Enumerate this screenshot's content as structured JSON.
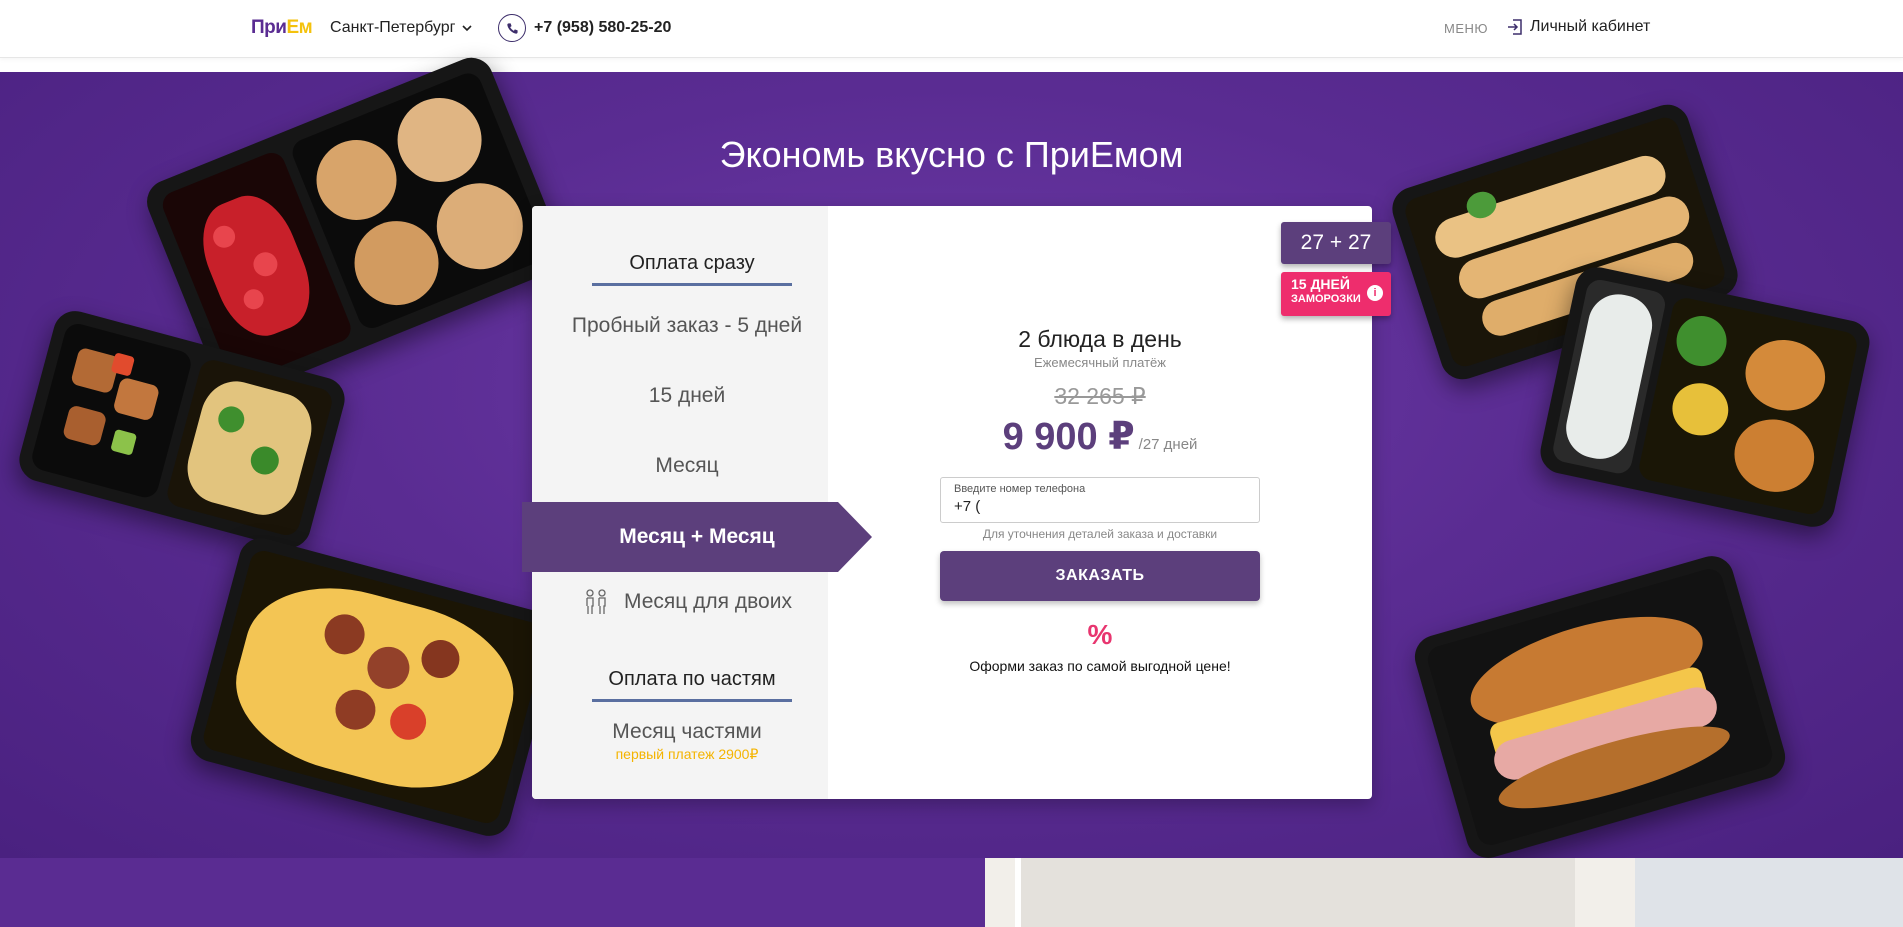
{
  "header": {
    "logo": {
      "part1": "При",
      "part2": "Ем"
    },
    "city": "Санкт-Петербург",
    "phone": "+7 (958) 580-25-20",
    "menu_label": "МЕНЮ",
    "cabinet_label": "Личный кабинет"
  },
  "hero": {
    "title": "Экономь вкусно с ПриЕмом"
  },
  "plans": {
    "group1_label": "Оплата сразу",
    "items": [
      {
        "label": "Пробный заказ - 5 дней"
      },
      {
        "label": "15 дней"
      },
      {
        "label": "Месяц"
      },
      {
        "label": "Месяц + Месяц",
        "active": true
      },
      {
        "label": "Месяц для двоих"
      }
    ],
    "group2_label": "Оплата по частям",
    "installment": {
      "label": "Месяц частями",
      "sub": "первый платеж 2900₽"
    }
  },
  "offer": {
    "title": "2 блюда в день",
    "subtitle": "Ежемесячный платёж",
    "old_price": "32 265 ₽",
    "price": "9 900 ₽",
    "period": "/27 дней",
    "phone_label": "Введите номер телефона",
    "phone_value": "+7 (",
    "hint": "Для уточнения деталей заказа и доставки",
    "order_button": "ЗАКАЗАТЬ",
    "percent_icon": "%",
    "promo_text": "Оформи заказ по самой выгодной цене!"
  },
  "badges": {
    "days": "27 + 27",
    "freeze_line1": "15 ДНЕЙ",
    "freeze_line2": "ЗАМОРОЗКИ",
    "info_icon": "i"
  },
  "colors": {
    "brand_purple": "#5a2c92",
    "accent_purple": "#5c3f7c",
    "freeze_pink": "#ee2d6d",
    "installment_yellow": "#f4b400"
  }
}
